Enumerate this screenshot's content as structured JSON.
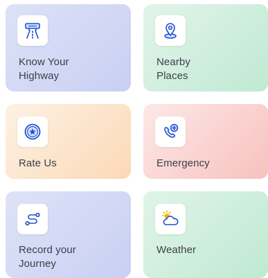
{
  "cards": [
    {
      "label": "Know Your\nHighway",
      "icon": "highway-icon"
    },
    {
      "label": "Nearby\nPlaces",
      "icon": "location-pin-icon"
    },
    {
      "label": "Rate Us",
      "icon": "star-badge-icon"
    },
    {
      "label": "Emergency",
      "icon": "phone-plus-icon"
    },
    {
      "label": "Record your\nJourney",
      "icon": "route-icon"
    },
    {
      "label": "Weather",
      "icon": "sun-cloud-icon"
    }
  ],
  "colors": {
    "icon_blue": "#1f4fd1",
    "icon_light_blue": "#cfe0ff",
    "text": "#3b3f47",
    "sun_yellow": "#f5b300"
  }
}
